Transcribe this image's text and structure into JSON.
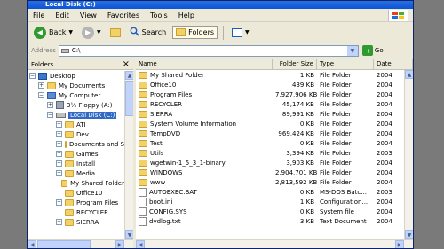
{
  "window": {
    "title": "Local Disk (C:)"
  },
  "menu": [
    "File",
    "Edit",
    "View",
    "Favorites",
    "Tools",
    "Help"
  ],
  "toolbar": {
    "back": "Back",
    "search": "Search",
    "folders": "Folders"
  },
  "address": {
    "label": "Address",
    "value": "C:\\",
    "go": "Go"
  },
  "folders_pane": {
    "title": "Folders",
    "close": "×",
    "tree": [
      {
        "label": "Desktop",
        "icon": "desktop-icon",
        "level": 0,
        "exp": "−"
      },
      {
        "label": "My Documents",
        "icon": "folder-icon",
        "level": 1,
        "exp": "+"
      },
      {
        "label": "My Computer",
        "icon": "computer-icon",
        "level": 1,
        "exp": "−"
      },
      {
        "label": "3½ Floppy (A:)",
        "icon": "floppy-icon",
        "level": 2,
        "exp": "+"
      },
      {
        "label": "Local Disk (C:)",
        "icon": "drive-icon",
        "level": 2,
        "exp": "−",
        "selected": true
      },
      {
        "label": "ATI",
        "icon": "folder-icon",
        "level": 3,
        "exp": "+"
      },
      {
        "label": "Dev",
        "icon": "folder-icon",
        "level": 3,
        "exp": "+"
      },
      {
        "label": "Documents and Se",
        "icon": "folder-icon",
        "level": 3,
        "exp": "+"
      },
      {
        "label": "Games",
        "icon": "folder-icon",
        "level": 3,
        "exp": "+"
      },
      {
        "label": "Install",
        "icon": "folder-icon",
        "level": 3,
        "exp": "+"
      },
      {
        "label": "Media",
        "icon": "folder-icon",
        "level": 3,
        "exp": "+"
      },
      {
        "label": "My Shared Folder",
        "icon": "folder-icon",
        "level": 3,
        "exp": ""
      },
      {
        "label": "Office10",
        "icon": "folder-icon",
        "level": 3,
        "exp": ""
      },
      {
        "label": "Program Files",
        "icon": "folder-icon",
        "level": 3,
        "exp": "+"
      },
      {
        "label": "RECYCLER",
        "icon": "folder-icon",
        "level": 3,
        "exp": ""
      },
      {
        "label": "SIERRA",
        "icon": "folder-icon",
        "level": 3,
        "exp": "+"
      }
    ]
  },
  "columns": {
    "name": "Name",
    "size": "Folder Size",
    "type": "Type",
    "date": "Date"
  },
  "files": [
    {
      "name": "My Shared Folder",
      "size": "1 KB",
      "type": "File Folder",
      "date": "2004",
      "icon": "folder"
    },
    {
      "name": "Office10",
      "size": "439 KB",
      "type": "File Folder",
      "date": "2004",
      "icon": "folder"
    },
    {
      "name": "Program Files",
      "size": "7,927,906 KB",
      "type": "File Folder",
      "date": "2004",
      "icon": "folder"
    },
    {
      "name": "RECYCLER",
      "size": "45,174 KB",
      "type": "File Folder",
      "date": "2004",
      "icon": "folder"
    },
    {
      "name": "SIERRA",
      "size": "89,991 KB",
      "type": "File Folder",
      "date": "2004",
      "icon": "folder"
    },
    {
      "name": "System Volume Information",
      "size": "0 KB",
      "type": "File Folder",
      "date": "2004",
      "icon": "folder"
    },
    {
      "name": "TempDVD",
      "size": "969,424 KB",
      "type": "File Folder",
      "date": "2004",
      "icon": "folder"
    },
    {
      "name": "Test",
      "size": "0 KB",
      "type": "File Folder",
      "date": "2004",
      "icon": "folder"
    },
    {
      "name": "Utils",
      "size": "3,394 KB",
      "type": "File Folder",
      "date": "2003",
      "icon": "folder"
    },
    {
      "name": "wgetwin-1_5_3_1-binary",
      "size": "3,903 KB",
      "type": "File Folder",
      "date": "2004",
      "icon": "folder"
    },
    {
      "name": "WINDOWS",
      "size": "2,904,701 KB",
      "type": "File Folder",
      "date": "2004",
      "icon": "folder"
    },
    {
      "name": "www",
      "size": "2,813,592 KB",
      "type": "File Folder",
      "date": "2004",
      "icon": "folder"
    },
    {
      "name": "AUTOEXEC.BAT",
      "size": "0 KB",
      "type": "MS-DOS Batc...",
      "date": "2003",
      "icon": "file"
    },
    {
      "name": "boot.ini",
      "size": "1 KB",
      "type": "Configuration...",
      "date": "2004",
      "icon": "file"
    },
    {
      "name": "CONFIG.SYS",
      "size": "0 KB",
      "type": "System file",
      "date": "2004",
      "icon": "file"
    },
    {
      "name": "dvdlog.txt",
      "size": "3 KB",
      "type": "Text Document",
      "date": "2004",
      "icon": "file"
    }
  ]
}
